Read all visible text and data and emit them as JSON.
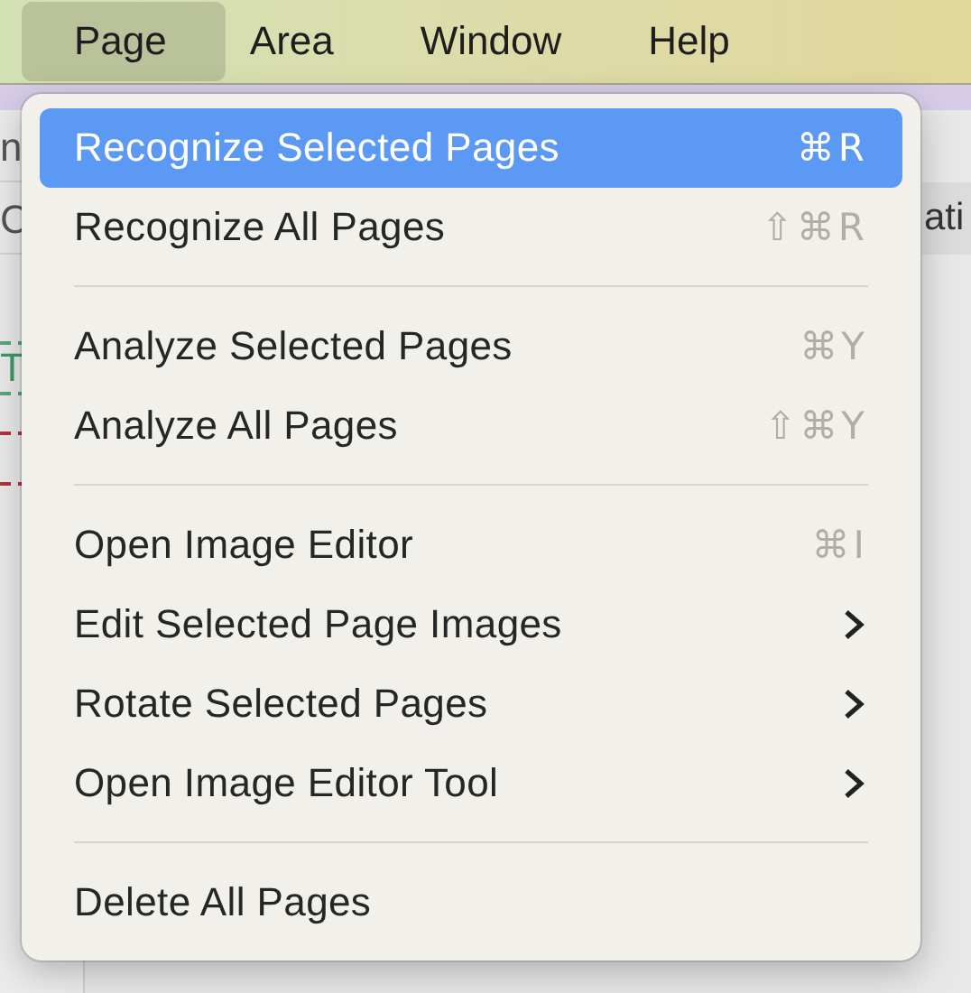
{
  "menu_bar": {
    "items": [
      {
        "label": "Page",
        "selected": true
      },
      {
        "label": "Area",
        "selected": false
      },
      {
        "label": "Window",
        "selected": false
      },
      {
        "label": "Help",
        "selected": false
      }
    ]
  },
  "background": {
    "left_texts": [
      "n",
      "C"
    ],
    "left_tag": "T",
    "right_text": "ati"
  },
  "menu": {
    "groups": [
      [
        {
          "kind": "command",
          "label": "Recognize Selected Pages",
          "shortcut": "⌘R",
          "selected": true
        },
        {
          "kind": "command",
          "label": "Recognize All Pages",
          "shortcut": "⇧⌘R",
          "selected": false
        }
      ],
      [
        {
          "kind": "command",
          "label": "Analyze Selected Pages",
          "shortcut": "⌘Y",
          "selected": false
        },
        {
          "kind": "command",
          "label": "Analyze All Pages",
          "shortcut": "⇧⌘Y",
          "selected": false
        }
      ],
      [
        {
          "kind": "command",
          "label": "Open Image Editor",
          "shortcut": "⌘I",
          "selected": false
        },
        {
          "kind": "submenu",
          "label": "Edit Selected Page Images",
          "selected": false
        },
        {
          "kind": "submenu",
          "label": "Rotate Selected Pages",
          "selected": false
        },
        {
          "kind": "submenu",
          "label": "Open Image Editor Tool",
          "selected": false
        }
      ],
      [
        {
          "kind": "command",
          "label": "Delete All Pages",
          "selected": false
        }
      ]
    ]
  }
}
